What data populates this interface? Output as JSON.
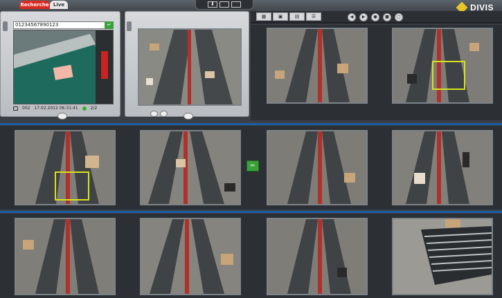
{
  "tabs": {
    "recherche": "Recherche",
    "live": "Live"
  },
  "brand": {
    "name": "DIVIS",
    "accent": "#e8c42b"
  },
  "search": {
    "value": "01234567890123",
    "ok_icon": "check-icon"
  },
  "record_info": {
    "cam_id": "002",
    "datetime": "17.02.2012 06:31:41",
    "page": "2/2"
  },
  "toolbar": {
    "tab_icons": [
      "grid-icon",
      "box-icon",
      "map-icon",
      "list-icon"
    ],
    "buttons": [
      "rewind-icon",
      "forward-icon",
      "camera-icon",
      "settings-icon",
      "fullscreen-icon"
    ]
  },
  "colors": {
    "highlight": "#d9e31a",
    "separator": "#1b5ea0",
    "tab_red": "#d92a22"
  }
}
